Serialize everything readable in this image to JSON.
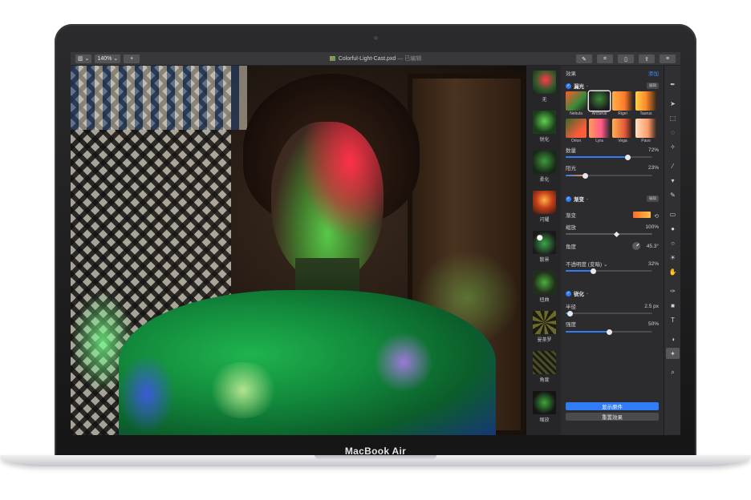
{
  "device": {
    "brand": "MacBook Air"
  },
  "toolbar": {
    "view_button": "▥ ⌄",
    "zoom": "140% ⌄",
    "add": "+",
    "document_title": "Colorful-Light-Cast.pxd",
    "edited_status": "— 已编辑",
    "right_icons": [
      "brush-icon",
      "crop-icon",
      "document-icon",
      "share-icon",
      "sliders-icon"
    ]
  },
  "effects_list": [
    {
      "label": "无"
    },
    {
      "label": "锐化"
    },
    {
      "label": "柔化"
    },
    {
      "label": "闪耀"
    },
    {
      "label": "散景"
    },
    {
      "label": "扭曲"
    },
    {
      "label": "曼荼罗"
    },
    {
      "label": "角度"
    },
    {
      "label": "缩放"
    }
  ],
  "panel": {
    "header_title": "效果",
    "header_action": "添加",
    "light_leak": {
      "title": "漏光",
      "tag": "编辑",
      "presets": [
        "Nebula",
        "Arcturus",
        "Rigel",
        "Taurus",
        "Orion",
        "Lyra",
        "Vega",
        "Pavo"
      ],
      "selected_preset": "Arcturus",
      "amount_label": "数量",
      "amount_value": "72%",
      "amount_fraction": 0.72,
      "sunlight_label": "阳光",
      "sunlight_value": "23%",
      "sunlight_fraction": 0.23
    },
    "gradient": {
      "title": "渐变",
      "tag": "编辑",
      "gradient_label": "渐变",
      "scale_label": "缩放",
      "scale_value": "100%",
      "scale_fraction": 0.6,
      "angle_label": "角度",
      "angle_value": "45.3°",
      "opacity_label": "不透明度 (变暗) ⌄",
      "opacity_value": "32%",
      "opacity_fraction": 0.32
    },
    "sharpen": {
      "title": "锐化",
      "radius_label": "半径",
      "radius_value": "2.5 px",
      "radius_fraction": 0.05,
      "intensity_label": "强度",
      "intensity_value": "50%",
      "intensity_fraction": 0.5
    },
    "show_original": "显示原件",
    "reset_effects": "重置效果"
  },
  "tools": [
    "pen-nib-icon",
    "arrow-icon",
    "rect-select-icon",
    "lasso-icon",
    "magic-wand-icon",
    "brush-icon",
    "bucket-icon",
    "pencil-icon",
    "eraser-icon",
    "repair-icon",
    "blur-icon",
    "sun-icon",
    "hand-icon",
    "pen-icon",
    "shape-icon",
    "text-icon",
    "color-icon",
    "star-effects-icon",
    "zoom-icon"
  ]
}
